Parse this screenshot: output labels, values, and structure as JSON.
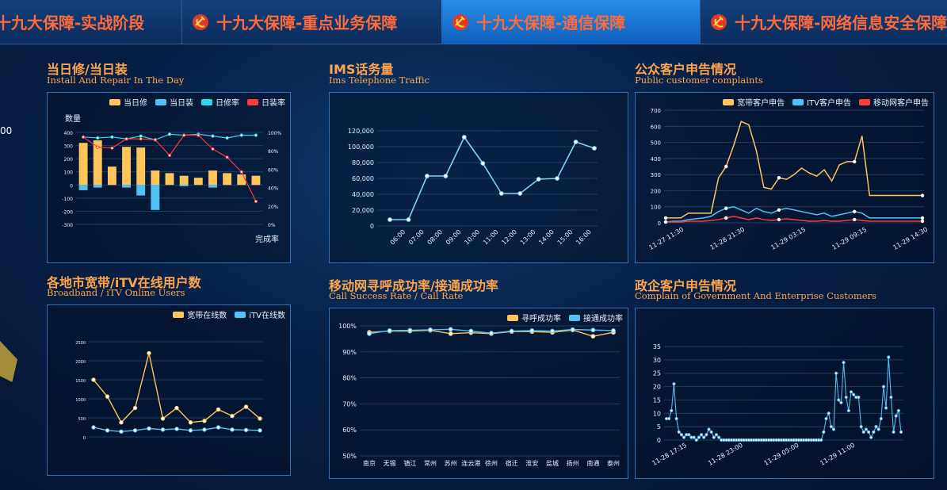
{
  "tabs": [
    {
      "label": "十九大保障-实战阶段",
      "active": false
    },
    {
      "label": "十九大保障-重点业务保障",
      "active": false
    },
    {
      "label": "十九大保障-通信保障",
      "active": true
    },
    {
      "label": "十九大保障-网络信息安全保障",
      "active": false
    }
  ],
  "icons": {
    "tab_icon": "hammer-sickle-icon"
  },
  "side": {
    "number": "00"
  },
  "colors": {
    "accent": "#ffa44a",
    "yellow": "#ffc55a",
    "blue": "#4fc3f7",
    "cyan": "#29d8f2",
    "red": "#ff3b3b"
  },
  "panels": {
    "p1": {
      "title": "当日修/当日装",
      "subtitle": "Install And Repair In The Day",
      "ylabel": "数量",
      "xlabel": "完成率",
      "legend": [
        "当日修",
        "当日装",
        "日修率",
        "日装率"
      ]
    },
    "p2": {
      "title": "IMS话务量",
      "subtitle": "Ims Telephone Traffic"
    },
    "p3": {
      "title": "公众客户申告情况",
      "subtitle": "Public customer complaints",
      "legend": [
        "宽带客户申告",
        "ITV客户申告",
        "移动网客户申告"
      ]
    },
    "p4": {
      "title": "各地市宽带/iTV在线用户数",
      "subtitle": "Broadband / iTV Online Users",
      "legend": [
        "宽带在线数",
        "iTV在线数"
      ]
    },
    "p5": {
      "title": "移动网寻呼成功率/接通成功率",
      "subtitle": "Call Success Rate / Call Rate",
      "legend": [
        "寻呼成功率",
        "接通成功率"
      ]
    },
    "p6": {
      "title": "政企客户申告情况",
      "subtitle": "Complain of Government And Enterprise Customers"
    }
  },
  "chart_data": [
    {
      "id": "p1",
      "type": "bar",
      "categories": [
        "",
        "",
        "",
        "",
        "",
        "",
        "",
        "",
        "",
        "",
        "",
        "",
        ""
      ],
      "ylim": [
        -300,
        400
      ],
      "y2lim": [
        0,
        100
      ],
      "y_ticks": [
        "400",
        "300",
        "200",
        "100",
        "0",
        "-100",
        "-200",
        "-300"
      ],
      "y2_ticks": [
        "100%",
        "80%",
        "60%",
        "40%",
        "20%",
        "0%"
      ],
      "series": [
        {
          "name": "当日修",
          "kind": "bar",
          "values": [
            320,
            340,
            140,
            290,
            285,
            110,
            90,
            70,
            55,
            110,
            90,
            80,
            70
          ]
        },
        {
          "name": "当日装",
          "kind": "bar",
          "values": [
            -40,
            -20,
            0,
            -20,
            -80,
            -190,
            0,
            -10,
            0,
            -20,
            0,
            0,
            0
          ]
        },
        {
          "name": "日修率",
          "kind": "line",
          "values": [
            95,
            94,
            95,
            93,
            96,
            92,
            98,
            97,
            98,
            96,
            94,
            97,
            97
          ]
        },
        {
          "name": "日装率",
          "kind": "line",
          "values": [
            95,
            84,
            83,
            93,
            93,
            92,
            75,
            97,
            97,
            82,
            73,
            57,
            25
          ]
        }
      ]
    },
    {
      "id": "p2",
      "type": "line",
      "x": [
        "06:00",
        "07:00",
        "08:00",
        "09:00",
        "10:00",
        "11:00",
        "12:00",
        "13:00",
        "14:00",
        "15:00",
        "16:00"
      ],
      "values": [
        8000,
        8000,
        63000,
        63000,
        112000,
        79000,
        41000,
        41000,
        59000,
        60000,
        106000,
        98000
      ],
      "ylim": [
        0,
        120000
      ],
      "y_ticks": [
        "120,000",
        "100,000",
        "80,000",
        "60,000",
        "40,000",
        "20,000",
        "0"
      ]
    },
    {
      "id": "p3",
      "type": "line",
      "x_ticks": [
        "11-27 11:30",
        "11-28 21:30",
        "11-29 03:15",
        "11-29 09:15",
        "11-29 14:30"
      ],
      "ylim": [
        0,
        700
      ],
      "y_ticks": [
        "700",
        "600",
        "500",
        "400",
        "300",
        "200",
        "100",
        "0"
      ],
      "series": [
        {
          "name": "宽带客户申告",
          "values": [
            30,
            30,
            30,
            60,
            60,
            60,
            60,
            280,
            350,
            480,
            630,
            610,
            450,
            220,
            210,
            280,
            270,
            300,
            340,
            310,
            290,
            330,
            260,
            360,
            380,
            380,
            540,
            170,
            170,
            170,
            170,
            170,
            170,
            170,
            170
          ]
        },
        {
          "name": "ITV客户申告",
          "values": [
            5,
            10,
            10,
            20,
            25,
            30,
            40,
            70,
            90,
            100,
            80,
            60,
            90,
            70,
            60,
            80,
            90,
            80,
            70,
            60,
            50,
            60,
            40,
            50,
            60,
            70,
            60,
            30,
            30,
            30,
            30,
            30,
            30,
            30,
            30
          ]
        },
        {
          "name": "移动网客户申告",
          "values": [
            5,
            5,
            5,
            10,
            10,
            10,
            15,
            20,
            30,
            40,
            30,
            20,
            30,
            20,
            15,
            20,
            25,
            20,
            15,
            10,
            10,
            15,
            10,
            10,
            15,
            20,
            15,
            10,
            10,
            10,
            10,
            10,
            10,
            10,
            10
          ]
        }
      ]
    },
    {
      "id": "p4",
      "type": "line",
      "categories": [
        "",
        "",
        "",
        "",
        "",
        "",
        "",
        "",
        "",
        "",
        "",
        "",
        ""
      ],
      "y_ticks": [
        "2500",
        "2000",
        "1500",
        "1000",
        "500",
        "0"
      ],
      "series": [
        {
          "name": "宽带在线数",
          "values": [
            1500,
            1060,
            380,
            760,
            2200,
            480,
            760,
            380,
            420,
            720,
            550,
            790,
            480
          ]
        },
        {
          "name": "iTV在线数",
          "values": [
            250,
            170,
            140,
            170,
            220,
            190,
            210,
            170,
            190,
            250,
            190,
            180,
            170
          ]
        }
      ]
    },
    {
      "id": "p5",
      "type": "line",
      "categories": [
        "南京",
        "无锡",
        "镇江",
        "常州",
        "苏州",
        "连云港",
        "徐州",
        "宿迁",
        "淮安",
        "盐城",
        "扬州",
        "南通",
        "泰州"
      ],
      "ylim": [
        50,
        100
      ],
      "y_ticks": [
        "100%",
        "90%",
        "80%",
        "70%",
        "60%",
        "50%"
      ],
      "series": [
        {
          "name": "寻呼成功率",
          "values": [
            97.5,
            98,
            98,
            98.3,
            97,
            97.4,
            97,
            97.8,
            97.8,
            97.5,
            98.4,
            96,
            97.5
          ]
        },
        {
          "name": "接通成功率",
          "values": [
            97,
            98.2,
            98.3,
            98.5,
            98.7,
            98,
            97.2,
            98,
            98.2,
            98,
            98.6,
            98.4,
            98.2
          ]
        }
      ]
    },
    {
      "id": "p6",
      "type": "line",
      "x_ticks": [
        "11-28 17:15",
        "11-28 23:00",
        "11-29 05:00",
        "11-29 11:00"
      ],
      "ylim": [
        0,
        35
      ],
      "y_ticks": [
        "35",
        "30",
        "25",
        "20",
        "15",
        "10",
        "5",
        "0"
      ],
      "values": [
        8,
        8,
        11,
        21,
        8,
        3,
        2,
        1,
        2,
        2,
        1,
        1,
        0,
        1,
        2,
        1,
        2,
        4,
        3,
        1,
        2,
        1,
        0,
        0,
        0,
        0,
        0,
        0,
        0,
        0,
        0,
        0,
        0,
        0,
        0,
        0,
        0,
        0,
        0,
        0,
        0,
        0,
        0,
        0,
        0,
        0,
        0,
        0,
        0,
        0,
        0,
        0,
        0,
        0,
        0,
        0,
        0,
        0,
        0,
        0,
        0,
        0,
        0,
        3,
        8,
        10,
        5,
        4,
        25,
        15,
        14,
        29,
        16,
        11,
        18,
        17,
        16,
        16,
        5,
        3,
        4,
        3,
        1,
        3,
        5,
        4,
        8,
        20,
        12,
        31,
        16,
        3,
        9,
        11,
        3
      ]
    }
  ]
}
